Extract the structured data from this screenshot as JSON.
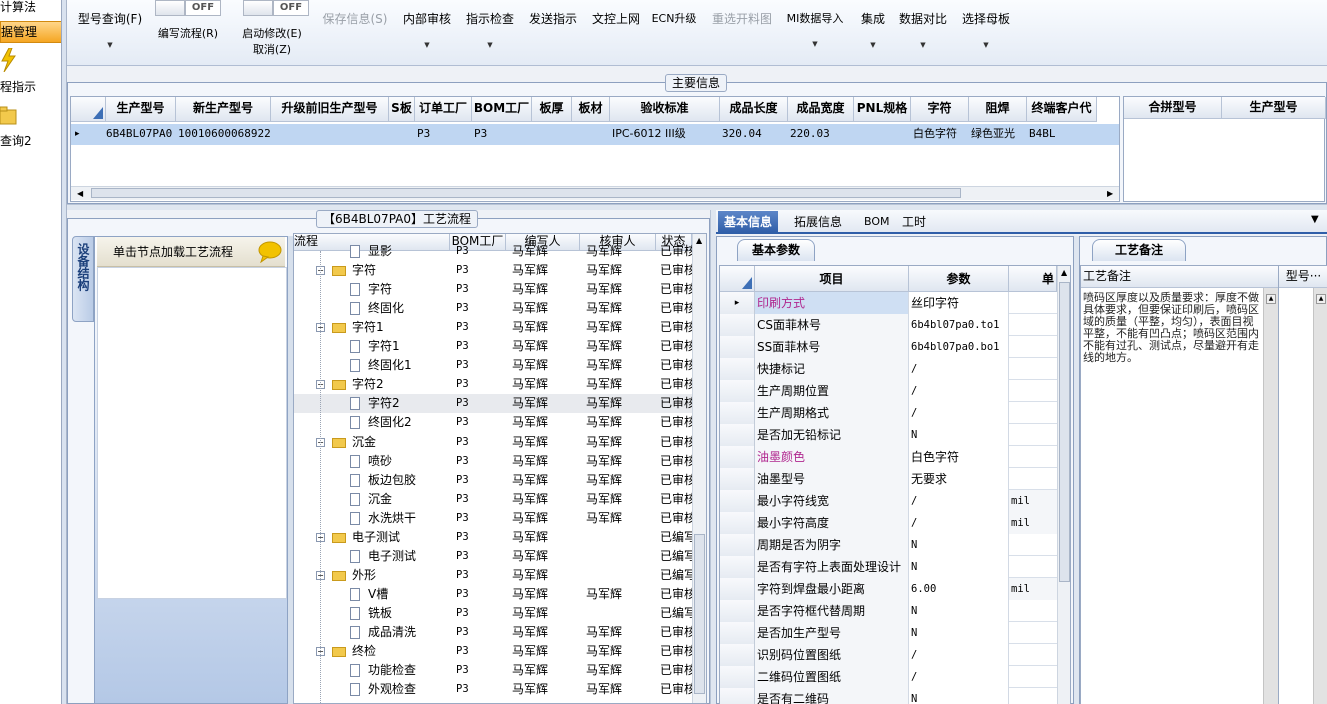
{
  "leftnav": {
    "items": [
      "计算法",
      "据管理",
      "程指示",
      "查询2"
    ]
  },
  "toolbar": {
    "buttons": [
      {
        "label": "型号查询(F)",
        "arrow": "▼"
      },
      {
        "label": "编写流程(R)"
      },
      {
        "label": "启动修改(E)"
      },
      {
        "label": "取消(Z)"
      },
      {
        "label": "保存信息(S)"
      },
      {
        "label": "内部审核",
        "arrow": "▼"
      },
      {
        "label": "指示检查",
        "arrow": "▼"
      },
      {
        "label": "发送指示"
      },
      {
        "label": "文控上网"
      },
      {
        "label": "ECN升级"
      },
      {
        "label": "重选开料图"
      },
      {
        "label": "MI数据导入",
        "arrow": "▼"
      },
      {
        "label": "集成",
        "arrow": "▼"
      },
      {
        "label": "数据对比",
        "arrow": "▼"
      },
      {
        "label": "选择母板",
        "arrow": "▼"
      }
    ],
    "toggle_off_label": "OFF"
  },
  "main_info": {
    "title": "主要信息",
    "columns": [
      "生产型号",
      "新生产型号",
      "升级前旧生产型号",
      "S板",
      "订单工厂",
      "BOM工厂",
      "板厚",
      "板材",
      "验收标准",
      "成品长度",
      "成品宽度",
      "PNL规格",
      "字符",
      "阻焊",
      "终端客户代"
    ],
    "rows": [
      [
        "6B4BL07PA0",
        "10010600068922",
        "",
        "",
        "P3",
        "P3",
        "",
        "",
        "IPC-6012 III级",
        "320.04",
        "220.03",
        "",
        "白色字符",
        "绿色亚光",
        "B4BL"
      ]
    ],
    "row_marker": "▸",
    "right_columns": [
      "合拼型号",
      "生产型号"
    ]
  },
  "process": {
    "title": "【6B4BL07PA0】工艺流程",
    "side_tab": "设备结构",
    "hint_button": "单击节点加载工艺流程",
    "tree_columns": [
      "流程",
      "BOM工厂",
      "编写人",
      "核审人",
      "状态"
    ],
    "rows": [
      {
        "name": "显影",
        "level": 1,
        "kind": "file",
        "bom": "P3",
        "author": "马军辉",
        "reviewer": "马军辉",
        "status": "已审核"
      },
      {
        "name": "字符",
        "level": 0,
        "kind": "folder",
        "bom": "P3",
        "author": "马军辉",
        "reviewer": "马军辉",
        "status": "已审核"
      },
      {
        "name": "字符",
        "level": 1,
        "kind": "file",
        "bom": "P3",
        "author": "马军辉",
        "reviewer": "马军辉",
        "status": "已审核"
      },
      {
        "name": "终固化",
        "level": 1,
        "kind": "file",
        "bom": "P3",
        "author": "马军辉",
        "reviewer": "马军辉",
        "status": "已审核"
      },
      {
        "name": "字符1",
        "level": 0,
        "kind": "folder",
        "bom": "P3",
        "author": "马军辉",
        "reviewer": "马军辉",
        "status": "已审核"
      },
      {
        "name": "字符1",
        "level": 1,
        "kind": "file",
        "bom": "P3",
        "author": "马军辉",
        "reviewer": "马军辉",
        "status": "已审核"
      },
      {
        "name": "终固化1",
        "level": 1,
        "kind": "file",
        "bom": "P3",
        "author": "马军辉",
        "reviewer": "马军辉",
        "status": "已审核"
      },
      {
        "name": "字符2",
        "level": 0,
        "kind": "folder",
        "bom": "P3",
        "author": "马军辉",
        "reviewer": "马军辉",
        "status": "已审核"
      },
      {
        "name": "字符2",
        "level": 1,
        "kind": "file",
        "bom": "P3",
        "author": "马军辉",
        "reviewer": "马军辉",
        "status": "已审核",
        "selected": true
      },
      {
        "name": "终固化2",
        "level": 1,
        "kind": "file",
        "bom": "P3",
        "author": "马军辉",
        "reviewer": "马军辉",
        "status": "已审核"
      },
      {
        "name": "沉金",
        "level": 0,
        "kind": "folder",
        "bom": "P3",
        "author": "马军辉",
        "reviewer": "马军辉",
        "status": "已审核"
      },
      {
        "name": "喷砂",
        "level": 1,
        "kind": "file",
        "bom": "P3",
        "author": "马军辉",
        "reviewer": "马军辉",
        "status": "已审核"
      },
      {
        "name": "板边包胶",
        "level": 1,
        "kind": "file",
        "bom": "P3",
        "author": "马军辉",
        "reviewer": "马军辉",
        "status": "已审核"
      },
      {
        "name": "沉金",
        "level": 1,
        "kind": "file",
        "bom": "P3",
        "author": "马军辉",
        "reviewer": "马军辉",
        "status": "已审核"
      },
      {
        "name": "水洗烘干",
        "level": 1,
        "kind": "file",
        "bom": "P3",
        "author": "马军辉",
        "reviewer": "马军辉",
        "status": "已审核"
      },
      {
        "name": "电子测试",
        "level": 0,
        "kind": "folder",
        "bom": "P3",
        "author": "马军辉",
        "reviewer": "",
        "status": "已编写"
      },
      {
        "name": "电子测试",
        "level": 1,
        "kind": "file",
        "bom": "P3",
        "author": "马军辉",
        "reviewer": "",
        "status": "已编写"
      },
      {
        "name": "外形",
        "level": 0,
        "kind": "folder",
        "bom": "P3",
        "author": "马军辉",
        "reviewer": "",
        "status": "已编写"
      },
      {
        "name": "V槽",
        "level": 1,
        "kind": "file",
        "bom": "P3",
        "author": "马军辉",
        "reviewer": "马军辉",
        "status": "已审核"
      },
      {
        "name": "铣板",
        "level": 1,
        "kind": "file",
        "bom": "P3",
        "author": "马军辉",
        "reviewer": "",
        "status": "已编写"
      },
      {
        "name": "成品清洗",
        "level": 1,
        "kind": "file",
        "bom": "P3",
        "author": "马军辉",
        "reviewer": "马军辉",
        "status": "已审核"
      },
      {
        "name": "终检",
        "level": 0,
        "kind": "folder",
        "bom": "P3",
        "author": "马军辉",
        "reviewer": "马军辉",
        "status": "已审核"
      },
      {
        "name": "功能检查",
        "level": 1,
        "kind": "file",
        "bom": "P3",
        "author": "马军辉",
        "reviewer": "马军辉",
        "status": "已审核"
      },
      {
        "name": "外观检查",
        "level": 1,
        "kind": "file",
        "bom": "P3",
        "author": "马军辉",
        "reviewer": "马军辉",
        "status": "已审核"
      }
    ]
  },
  "basic": {
    "tabs": [
      "基本信息",
      "拓展信息",
      "BOM",
      "工时"
    ],
    "subtitle": "基本参数",
    "columns": [
      "项目",
      "参数",
      "单"
    ],
    "rows": [
      {
        "item": "印刷方式",
        "value": "丝印字符",
        "unit": "",
        "highlight": true,
        "current": true
      },
      {
        "item": "CS面菲林号",
        "value": "6b4bl07pa0.to1",
        "unit": ""
      },
      {
        "item": "SS面菲林号",
        "value": "6b4bl07pa0.bo1",
        "unit": ""
      },
      {
        "item": "快捷标记",
        "value": "/",
        "unit": ""
      },
      {
        "item": "生产周期位置",
        "value": "/",
        "unit": ""
      },
      {
        "item": "生产周期格式",
        "value": "/",
        "unit": ""
      },
      {
        "item": "是否加无铅标记",
        "value": "N",
        "unit": ""
      },
      {
        "item": "油墨颜色",
        "value": "白色字符",
        "unit": "",
        "highlight": true
      },
      {
        "item": "油墨型号",
        "value": "无要求",
        "unit": ""
      },
      {
        "item": "最小字符线宽",
        "value": "/",
        "unit": "mil"
      },
      {
        "item": "最小字符高度",
        "value": "/",
        "unit": "mil"
      },
      {
        "item": "周期是否为阴字",
        "value": "N",
        "unit": ""
      },
      {
        "item": "是否有字符上表面处理设计",
        "value": "N",
        "unit": ""
      },
      {
        "item": "字符到焊盘最小距离",
        "value": "6.00",
        "unit": "mil"
      },
      {
        "item": "是否字符框代替周期",
        "value": "N",
        "unit": ""
      },
      {
        "item": "是否加生产型号",
        "value": "N",
        "unit": ""
      },
      {
        "item": "识别码位置图纸",
        "value": "/",
        "unit": ""
      },
      {
        "item": "二维码位置图纸",
        "value": "/",
        "unit": ""
      },
      {
        "item": "是否有二维码",
        "value": "N",
        "unit": ""
      }
    ]
  },
  "remark": {
    "title": "工艺备注",
    "header": "工艺备注",
    "header2": "型号···",
    "text": "喷码区厚度以及质量要求：厚度不做具体要求，但要保证印刷后，喷码区域的质量（平整，均匀），表面目视平整，不能有凹凸点；喷码区范围内不能有过孔、测试点，尽量避开有走线的地方。"
  }
}
